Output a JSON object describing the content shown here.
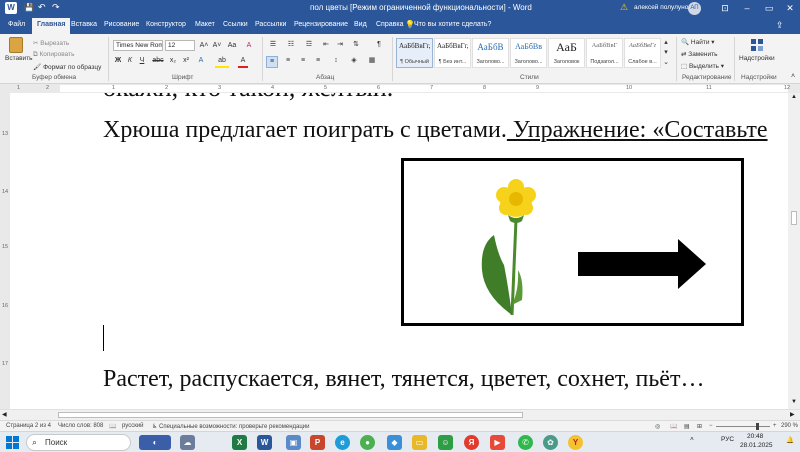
{
  "window": {
    "title": "пол цветы [Режим ограниченной функциональности] - Word",
    "user_name": "алексей полулунов",
    "user_initials": "АП",
    "minimize": "–",
    "restore": "▭",
    "close": "✕"
  },
  "tabs": [
    "Файл",
    "Главная",
    "Вставка",
    "Рисование",
    "Конструктор",
    "Макет",
    "Ссылки",
    "Рассылки",
    "Рецензирование",
    "Вид",
    "Справка"
  ],
  "tell_me": "Что вы хотите сделать?",
  "ribbon": {
    "clipboard": {
      "paste": "Вставить",
      "cut": "Вырезать",
      "copy": "Копировать",
      "format_painter": "Формат по образцу",
      "label": "Буфер обмена"
    },
    "font": {
      "name": "Times New Roman",
      "size": "12",
      "label": "Шрифт",
      "bold": "Ж",
      "italic": "К",
      "underline": "Ч",
      "strike": "abc",
      "sub": "x₂",
      "sup": "x²",
      "grow": "A˄",
      "shrink": "A˅",
      "case": "Aa",
      "clear": "A",
      "highlight": "ab",
      "color": "A"
    },
    "paragraph": {
      "label": "Абзац",
      "pilcrow": "¶"
    },
    "styles": {
      "label": "Стили",
      "items": [
        {
          "preview": "АаБбВвГг,",
          "name": "¶ Обычный"
        },
        {
          "preview": "АаБбВвГг,",
          "name": "¶ Без инт..."
        },
        {
          "preview": "АаБбВ",
          "name": "Заголово..."
        },
        {
          "preview": "АаБбВв",
          "name": "Заголово..."
        },
        {
          "preview": "АаБ",
          "name": "Заголовок"
        },
        {
          "preview": "АаБбВвГ",
          "name": "Подзагол..."
        },
        {
          "preview": "АаБбВвГг",
          "name": "Слабое в..."
        }
      ]
    },
    "editing": {
      "find": "Найти",
      "replace": "Заменить",
      "select": "Выделить",
      "label": "Редактирование"
    },
    "addins": {
      "button": "Надстройки",
      "label": "Надстройки"
    }
  },
  "ruler": {
    "h_ticks": [
      "1",
      "2",
      "1",
      "2",
      "3",
      "4",
      "5",
      "6",
      "7",
      "8",
      "9",
      "10",
      "11",
      "12"
    ],
    "v_ticks": [
      "13",
      "14",
      "15",
      "16",
      "17"
    ]
  },
  "document": {
    "line_top_partial": "окажи, кто такой, желтый.",
    "line1_start": "Хрюша предлагает поиграть  с цветами.",
    "line1_underlined": " Упражнение:  «Составьте",
    "line_bottom": "Растет, распускается, вянет, тянется, цветет, сохнет, пьёт…"
  },
  "statusbar": {
    "page": "Страница 2 из 4",
    "words": "Число слов: 808",
    "language": "русский",
    "accessibility": "Специальные возможности: проверьте рекомендации",
    "zoom": "290 %"
  },
  "taskbar": {
    "search_placeholder": "Поиск",
    "language": "РУС",
    "time": "20:48",
    "date": "28.01.2025"
  }
}
